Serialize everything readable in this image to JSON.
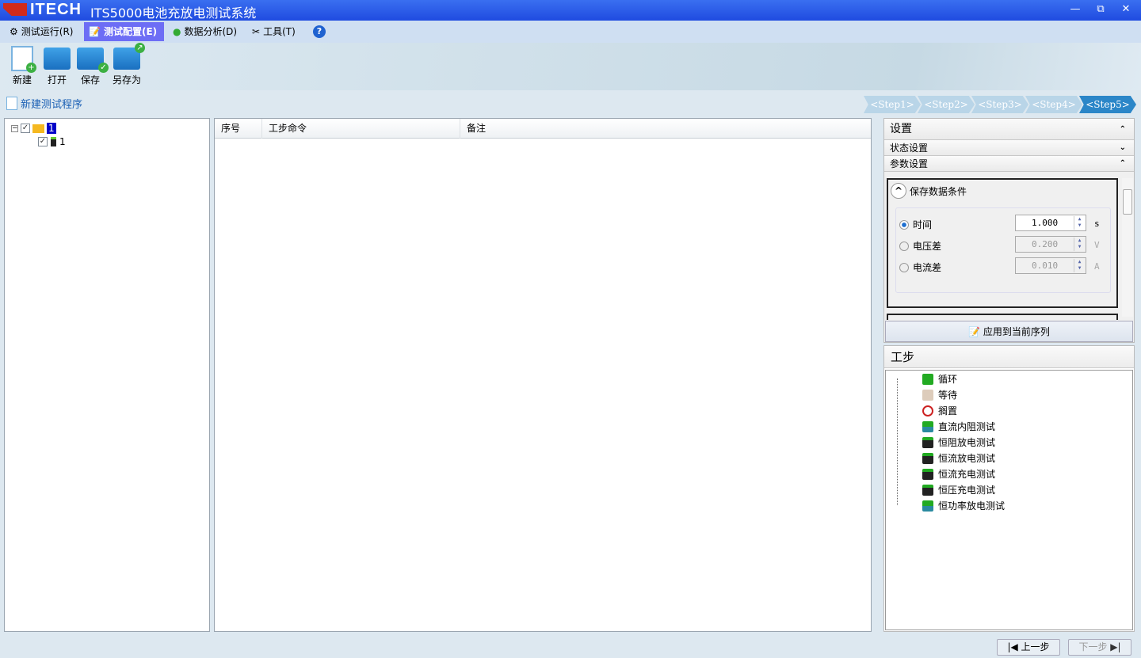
{
  "title": {
    "logo": "ITECH",
    "app": "ITS5000电池充放电测试系统",
    "minimize": "—",
    "restore": "⧉",
    "close": "✕"
  },
  "menu": [
    {
      "label": "测试运行(R)",
      "icon": "gear-icon"
    },
    {
      "label": "测试配置(E)",
      "icon": "config-icon",
      "active": true
    },
    {
      "label": "数据分析(D)",
      "icon": "analysis-icon"
    },
    {
      "label": "工具(T)",
      "icon": "tools-icon"
    },
    {
      "label": "?",
      "icon": "help-icon"
    }
  ],
  "toolbar": {
    "new": "新建",
    "open": "打开",
    "save": "保存",
    "saveas": "另存为"
  },
  "new_program": "新建测试程序",
  "steps": [
    "<Step1>",
    "<Step2>",
    "<Step3>",
    "<Step4>",
    "<Step5>"
  ],
  "active_step": 4,
  "tree": {
    "root": "1",
    "child": "1"
  },
  "grid": {
    "columns": [
      "序号",
      "工步命令",
      "备注"
    ]
  },
  "settings": {
    "title": "设置",
    "status": "状态设置",
    "params": "参数设置",
    "group": "保存数据条件",
    "options": [
      {
        "label": "时间",
        "value": "1.000",
        "unit": "s",
        "selected": true
      },
      {
        "label": "电压差",
        "value": "0.200",
        "unit": "V",
        "selected": false
      },
      {
        "label": "电流差",
        "value": "0.010",
        "unit": "A",
        "selected": false
      }
    ],
    "apply": "应用到当前序列"
  },
  "workstep": {
    "title": "工步",
    "items": [
      "循环",
      "等待",
      "搁置",
      "直流内阻测试",
      "恒阻放电测试",
      "恒流放电测试",
      "恒流充电测试",
      "恒压充电测试",
      "恒功率放电测试"
    ]
  },
  "nav": {
    "prev": "上一步",
    "next": "下一步"
  }
}
